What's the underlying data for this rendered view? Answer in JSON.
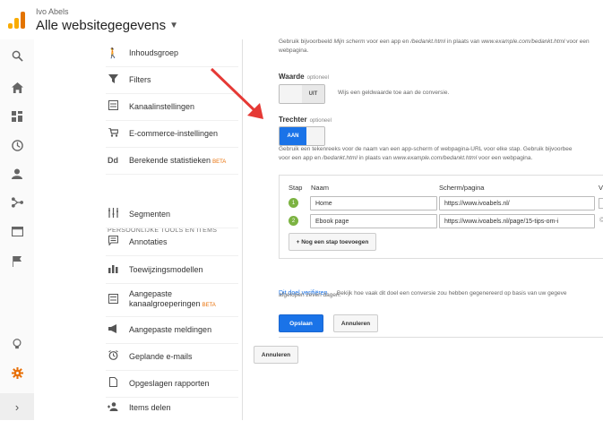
{
  "header": {
    "account_name": "Ivo Abels",
    "property_title": "Alle websitegegevens"
  },
  "rail": {
    "icons": [
      "search-icon",
      "home-icon",
      "dashboard-icon",
      "clock-icon",
      "person-icon",
      "acquisition-icon",
      "behavior-icon",
      "flag-icon"
    ],
    "bottom_icons": [
      "lightbulb-icon",
      "gear-icon"
    ],
    "expand_label": "›"
  },
  "menu": {
    "items_top": [
      {
        "label": "Inhoudsgroep",
        "icon": "walk-icon"
      },
      {
        "label": "Filters",
        "icon": "filter-icon"
      },
      {
        "label": "Kanaalinstellingen",
        "icon": "channel-icon"
      },
      {
        "label": "E-commerce-instellingen",
        "icon": "cart-icon"
      },
      {
        "label": "Berekende statistieken",
        "icon": "dd-icon",
        "badge": "BETA"
      }
    ],
    "section_title": "PERSOONLIJKE TOOLS EN ITEMS",
    "items_personal": [
      {
        "label": "Segmenten",
        "icon": "segment-icon"
      },
      {
        "label": "Annotaties",
        "icon": "annotation-icon"
      },
      {
        "label": "Toewijzingsmodellen",
        "icon": "bar-chart-icon"
      },
      {
        "label": "Aangepaste kanaalgroeperingen",
        "icon": "channel-group-icon",
        "badge": "BETA"
      },
      {
        "label": "Aangepaste meldingen",
        "icon": "megaphone-icon"
      },
      {
        "label": "Geplande e-mails",
        "icon": "alarm-icon"
      },
      {
        "label": "Opgeslagen rapporten",
        "icon": "document-icon"
      },
      {
        "label": "Items delen",
        "icon": "share-person-icon"
      }
    ]
  },
  "goal": {
    "top_help": [
      "Gebruik bijvoorbeeld",
      "Mijn scherm",
      " voor een app en ",
      "/bedankt.html",
      " in plaats van ",
      "www.example.com/bedankt.html",
      " voor een",
      "webpagina."
    ],
    "value": {
      "label": "Waarde",
      "optional": "optioneel",
      "toggle_off": "UIT",
      "help": "Wijs een geldwaarde toe aan de conversie."
    },
    "funnel": {
      "label": "Trechter",
      "optional": "optioneel",
      "toggle_on": "AAN",
      "help": [
        "Gebruik een tekenreeks voor de naam van een app-scherm of webpagina-URL voor elke stap. Gebruik bijvoorbee",
        "voor een app en ",
        "/bedankt.html",
        " in plaats van ",
        "www.example.com/bedankt.html",
        " voor een webpagina."
      ]
    },
    "steps": {
      "headers": {
        "step": "Stap",
        "name": "Naam",
        "screen": "Scherm/pagina",
        "required": "V"
      },
      "rows": [
        {
          "num": "1",
          "name": "Home",
          "page": "https://www.ivoabels.nl/"
        },
        {
          "num": "2",
          "name": "Ebook page",
          "page": "https://www.ivoabels.nl/page/15-tips-om-i"
        }
      ],
      "add_step": "+ Nog een stap toevoegen"
    },
    "verify": {
      "link": "Dit doel verifiëren",
      "text": "Bekijk hoe vaak dit doel een conversie zou hebben gegenereerd op basis van uw gegeve",
      "text2": "afgelopen zeven dagen."
    },
    "save": "Opslaan",
    "cancel": "Annuleren",
    "outer_cancel": "Annuleren"
  },
  "colors": {
    "accent": "#1a73e8",
    "arrow": "#e53935",
    "step_dot": "#7cb342",
    "beta": "#e8710a",
    "gear": "#e8710a"
  }
}
